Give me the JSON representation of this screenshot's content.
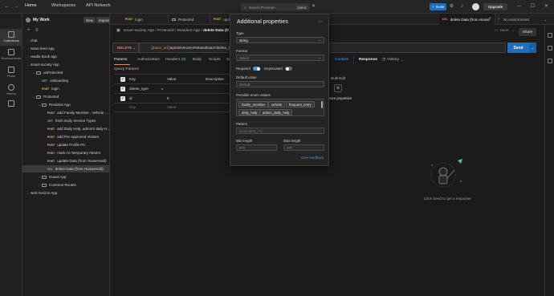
{
  "topbar": {
    "home": "Home",
    "workspaces": "Workspaces",
    "api_network": "API Network",
    "new": "New",
    "import": "Import",
    "search_placeholder": "Search Postman",
    "search_shortcut": "Ctrl K",
    "invite": "Invite",
    "upgrade": "Upgrade"
  },
  "rail": {
    "items": [
      "Collections",
      "Environments",
      "Flows",
      "History"
    ]
  },
  "sidebar": {
    "title": "My Work",
    "items": [
      {
        "label": "chat",
        "method": "",
        "type": "collection"
      },
      {
        "label": "news-feed App",
        "method": "",
        "type": "collection"
      },
      {
        "label": "readle Book app",
        "method": "",
        "type": "collection"
      },
      {
        "label": "smart-society App",
        "method": "",
        "type": "collection"
      },
      {
        "label": "unProtected",
        "method": "",
        "type": "folder"
      },
      {
        "label": "onBoarding",
        "method": "GET",
        "type": "request"
      },
      {
        "label": "login",
        "method": "POST",
        "type": "request"
      },
      {
        "label": "Protected",
        "method": "",
        "type": "folder"
      },
      {
        "label": "Resident App",
        "method": "",
        "type": "folder"
      },
      {
        "label": "add Family Member , Vehicle , ...",
        "method": "POST",
        "type": "request"
      },
      {
        "label": "fetch Daily Service Types",
        "method": "GET",
        "type": "request"
      },
      {
        "label": "add Daily Help, admin's daily H...",
        "method": "POST",
        "type": "request"
      },
      {
        "label": "add Pre Approved Visitors",
        "method": "POST",
        "type": "request"
      },
      {
        "label": "update Profile Pic",
        "method": "POST",
        "type": "request"
      },
      {
        "label": "mark As Temporary Absent",
        "method": "POST",
        "type": "request"
      },
      {
        "label": "update Data (from HouseHold)",
        "method": "POST",
        "type": "request"
      },
      {
        "label": "delete Data (from HouseHold)",
        "method": "DEL",
        "type": "request"
      },
      {
        "label": "Guard App",
        "method": "",
        "type": "folder"
      },
      {
        "label": "Common Routes",
        "method": "",
        "type": "folder"
      },
      {
        "label": "web horizon App",
        "method": "",
        "type": "collection"
      }
    ]
  },
  "tabs": [
    {
      "method": "POST",
      "label": "login"
    },
    {
      "method": "",
      "label": "Protected"
    },
    {
      "method": "POST",
      "label": "update"
    },
    {
      "method": "DEL",
      "label": "delete Data (from House"
    }
  ],
  "environment": "No environment",
  "breadcrumb": {
    "path": "smart-society App  /  Protected  /  Resident App  /",
    "current": "delete Data (fr"
  },
  "request": {
    "method": "DELETE",
    "url_var": "{{base_url}}",
    "url_path": "api/deleteUserRelatedData?delete_t",
    "send": "Send",
    "save": "Save",
    "share": "Share"
  },
  "request_tabs": {
    "params": "Params",
    "authorization": "Authorization",
    "headers": "Headers",
    "headers_count": "(8)",
    "body": "Body",
    "scripts": "Scripts",
    "settings": "Se"
  },
  "params": {
    "title": "Query Params",
    "columns": [
      "Key",
      "Value",
      "Description"
    ],
    "rows": [
      {
        "key": "delete_type",
        "value": "",
        "checked": true
      },
      {
        "key": "id",
        "value": "8",
        "checked": true
      },
      {
        "key": "Key",
        "value": "Value",
        "checked": false
      }
    ],
    "bulk_edit": "Bulk Edit",
    "add_more": "Add more properties"
  },
  "response": {
    "cookies": "Cookies",
    "tab": "Response",
    "history": "History",
    "empty_text": "Click Send to get a response"
  },
  "popup": {
    "title": "Additional properties",
    "type_label": "Type",
    "type_value": "string",
    "format_label": "Format",
    "format_placeholder": "Select",
    "required_label": "Required",
    "required_on": true,
    "deprecated_label": "Deprecated",
    "deprecated_on": false,
    "default_label": "Default value",
    "default_placeholder": "Default",
    "enum_label": "Possible enum values",
    "enum_values": [
      "family_member",
      "vehicle",
      "frequent_entry",
      "daily_help",
      "admin_daily_help"
    ],
    "pattern_label": "Pattern",
    "pattern_placeholder": "[a-zA-Z0-9_\\-\\-]",
    "min_label": "Min length",
    "min_placeholder": "###",
    "max_label": "Max length",
    "max_placeholder": "###",
    "feedback": "Give feedback"
  },
  "colors": {
    "accent_orange": "#e2884c",
    "send_blue": "#1e6fbf",
    "link_blue": "#3f9be8",
    "delete_red": "#d77f7f",
    "get_green": "#58c78c",
    "post_yellow": "#e0c05a"
  }
}
